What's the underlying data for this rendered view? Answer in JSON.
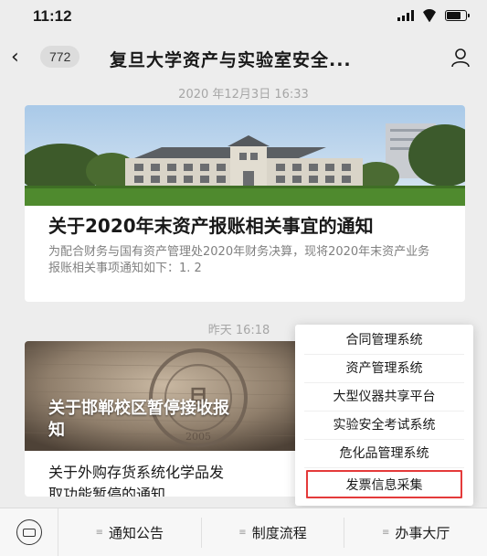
{
  "status": {
    "time": "11:12",
    "battery_level": 0.75
  },
  "nav": {
    "back_icon": "‹",
    "unread_count": "772",
    "title": "复旦大学资产与实验室安全...",
    "profile_icon": "person-icon"
  },
  "feed": [
    {
      "timestamp": "2020 年12月3日 16:33",
      "title": "关于2020年末资产报账相关事宜的通知",
      "description": "为配合财务与国有资产管理处2020年财务决算，现将2020年末资产业务报账相关事项通知如下：1. 2"
    },
    {
      "timestamp": "昨天 16:18",
      "title": "关于邯郸校区暂停接收报",
      "title_line2": "知",
      "subtitle": "关于外购存货系统化学品发",
      "subtitle_line2": "取功能暂停的通知",
      "badge_text": "2005"
    }
  ],
  "popup_menu": {
    "items": [
      {
        "label": "合同管理系统"
      },
      {
        "label": "资产管理系统"
      },
      {
        "label": "大型仪器共享平台"
      },
      {
        "label": "实验安全考试系统"
      },
      {
        "label": "危化品管理系统"
      },
      {
        "label": "发票信息采集"
      }
    ],
    "highlight_color": "#e43a3a"
  },
  "bottom_menu": {
    "keyboard_icon": "keyboard-icon",
    "tabs": [
      {
        "label": "通知公告"
      },
      {
        "label": "制度流程"
      },
      {
        "label": "办事大厅"
      }
    ]
  }
}
